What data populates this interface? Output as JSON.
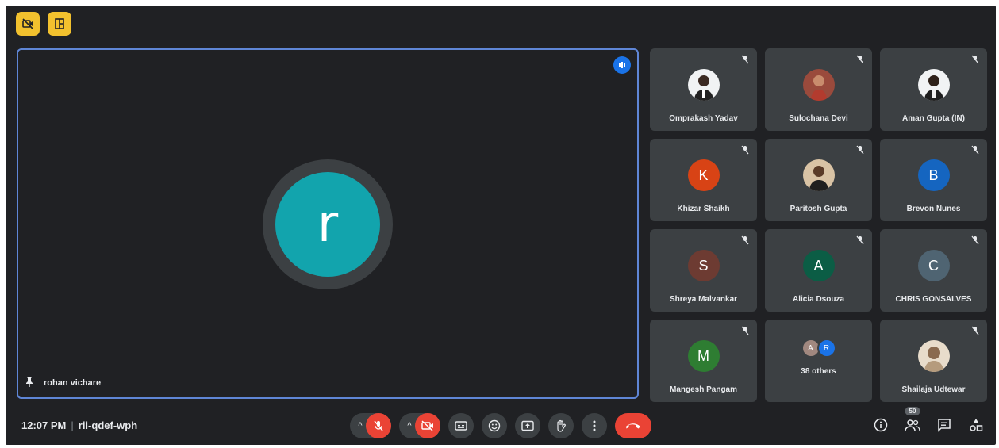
{
  "meeting": {
    "time": "12:07 PM",
    "code": "rii-qdef-wph",
    "participant_count": "50"
  },
  "main_tile": {
    "name": "rohan vichare",
    "initial": "r",
    "avatar_color": "#12a4ad"
  },
  "tiles": [
    {
      "name": "Omprakash Yadav",
      "type": "photo"
    },
    {
      "name": "Sulochana Devi",
      "type": "photo"
    },
    {
      "name": "Aman Gupta (IN)",
      "type": "photo"
    },
    {
      "name": "Khizar Shaikh",
      "initial": "K",
      "color": "#d84315"
    },
    {
      "name": "Paritosh Gupta",
      "type": "photo"
    },
    {
      "name": "Brevon Nunes",
      "initial": "B",
      "color": "#1565c0"
    },
    {
      "name": "Shreya Malvankar",
      "initial": "S",
      "color": "#6d3b32"
    },
    {
      "name": "Alicia Dsouza",
      "initial": "A",
      "color": "#0b5d45"
    },
    {
      "name": "CHRIS GONSALVES",
      "initial": "C",
      "color": "#4f6472"
    },
    {
      "name": "Mangesh Pangam",
      "initial": "M",
      "color": "#2e7d32"
    },
    {
      "name": "38 others",
      "others": [
        "A",
        "R"
      ],
      "others_colors": [
        "#a1887f",
        "#1a73e8"
      ]
    },
    {
      "name": "Shailaja Udtewar",
      "type": "photo"
    }
  ],
  "icons": {
    "top_left": [
      "video-off-icon",
      "layout-icon"
    ],
    "controls": [
      "mic-off-icon",
      "camera-off-icon",
      "captions-icon",
      "emoji-icon",
      "present-icon",
      "raise-hand-icon",
      "more-options-icon",
      "end-call-icon"
    ],
    "right": [
      "info-icon",
      "people-icon",
      "chat-icon",
      "activities-icon"
    ]
  }
}
